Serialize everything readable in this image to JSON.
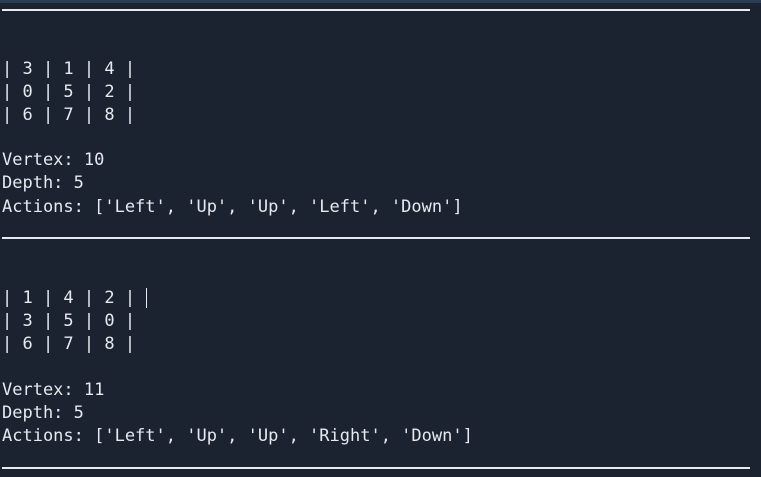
{
  "separator": "—",
  "blocks": [
    {
      "board_rows": [
        "| 3 | 1 | 4 |",
        "| 0 | 5 | 2 |",
        "| 6 | 7 | 8 |"
      ],
      "vertex_text": "Vertex: 10",
      "depth_text": "Depth: 5",
      "actions_text": "Actions: ['Left', 'Up', 'Up', 'Left', 'Down']"
    },
    {
      "board_rows": [
        "| 1 | 4 | 2 |",
        "| 3 | 5 | 0 |",
        "| 6 | 7 | 8 |"
      ],
      "vertex_text": "Vertex: 11",
      "depth_text": "Depth: 5",
      "actions_text": "Actions: ['Left', 'Up', 'Up', 'Right', 'Down']"
    }
  ]
}
